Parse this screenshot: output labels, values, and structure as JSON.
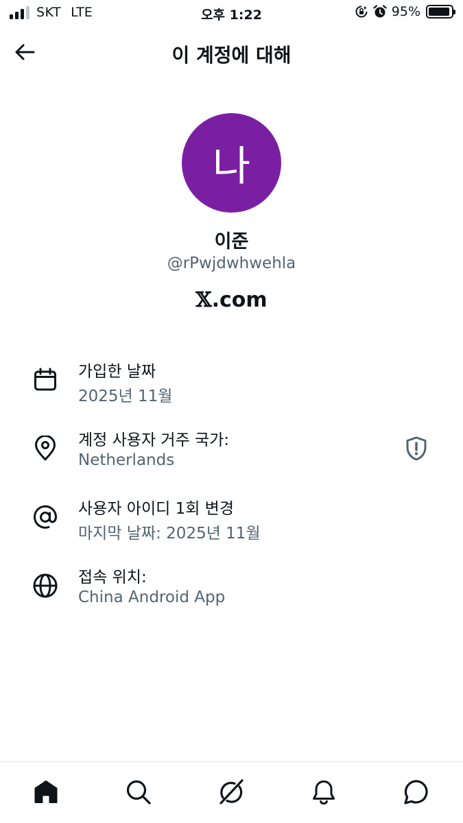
{
  "status_bar": {
    "carrier": "SKT",
    "network": "LTE",
    "time": "오후 1:22",
    "battery_percent": "95%",
    "battery_level": 0.95,
    "icons": [
      "signal-bars-icon",
      "rotation-lock-icon",
      "alarm-icon",
      "battery-icon"
    ]
  },
  "header": {
    "title": "이 계정에 대해",
    "back_icon": "arrow-left-icon"
  },
  "profile": {
    "avatar_initial": "나",
    "avatar_color": "#7b1fa2",
    "name": "이준",
    "handle": "@rPwjdwhwehla",
    "platform_x": "𝕏",
    "platform_rest": ".com"
  },
  "info": [
    {
      "icon": "calendar-icon",
      "label": "가입한 날짜",
      "value": "2025년 11월"
    },
    {
      "icon": "location-pin-icon",
      "label": "계정 사용자 거주 국가:",
      "value": "Netherlands",
      "side_icon": "shield-alert-icon"
    },
    {
      "icon": "at-sign-icon",
      "label": "사용자 아이디 1회 변경",
      "value": "마지막 날짜: 2025년 11월"
    },
    {
      "icon": "globe-icon",
      "label": "접속 위치:",
      "value": "China Android App"
    }
  ],
  "bottom_nav": [
    "home-icon",
    "search-icon",
    "grok-icon",
    "notifications-bell-icon",
    "messages-icon"
  ],
  "colors": {
    "text_primary": "#0f1419",
    "text_secondary": "#536471",
    "divider": "#dfe3e6"
  }
}
